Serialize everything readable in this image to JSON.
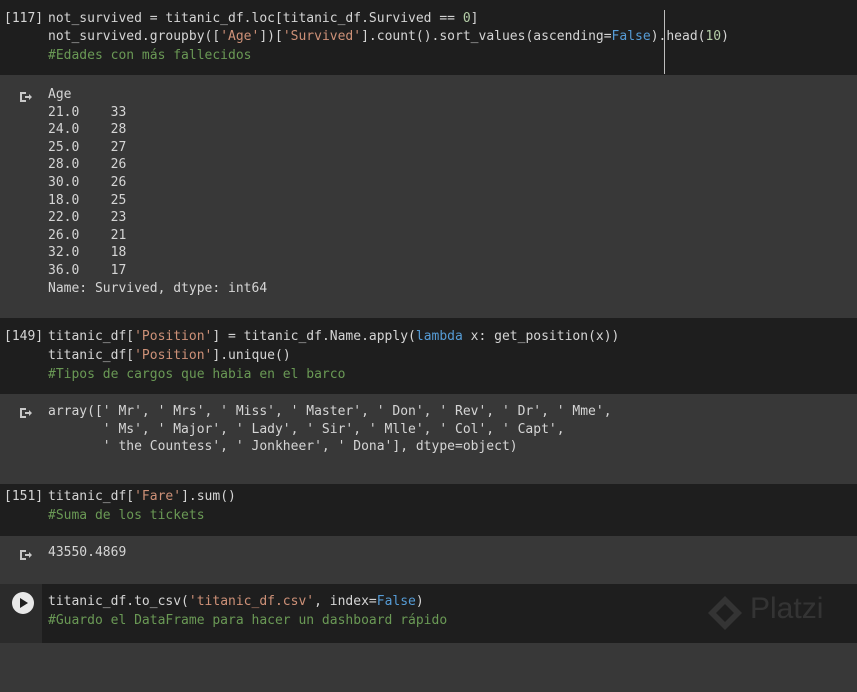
{
  "cells": [
    {
      "prompt": "[117]",
      "code_lines": [
        [
          {
            "t": "not_survived = titanic_df.loc[titanic_df.Survived == "
          },
          {
            "t": "0",
            "c": "num"
          },
          {
            "t": "]"
          }
        ],
        [
          {
            "t": "not_survived.groupby(["
          },
          {
            "t": "'Age'",
            "c": "str"
          },
          {
            "t": "])["
          },
          {
            "t": "'Survived'",
            "c": "str"
          },
          {
            "t": "].count().sort_values(ascending="
          },
          {
            "t": "False",
            "c": "kw"
          },
          {
            "t": ").head("
          },
          {
            "t": "10",
            "c": "num"
          },
          {
            "t": ")"
          }
        ],
        [
          {
            "t": "#Edades con más fallecidos",
            "c": "cmt"
          }
        ]
      ],
      "output": "Age\n21.0    33\n24.0    28\n25.0    27\n28.0    26\n30.0    26\n18.0    25\n22.0    23\n26.0    21\n32.0    18\n36.0    17\nName: Survived, dtype: int64"
    },
    {
      "prompt": "[149]",
      "code_lines": [
        [
          {
            "t": "titanic_df["
          },
          {
            "t": "'Position'",
            "c": "str"
          },
          {
            "t": "] = titanic_df.Name.apply("
          },
          {
            "t": "lambda",
            "c": "kw"
          },
          {
            "t": " x: get_position(x))"
          }
        ],
        [
          {
            "t": "titanic_df["
          },
          {
            "t": "'Position'",
            "c": "str"
          },
          {
            "t": "].unique()"
          }
        ],
        [
          {
            "t": "#Tipos de cargos que habia en el barco",
            "c": "cmt"
          }
        ]
      ],
      "output": "array([' Mr', ' Mrs', ' Miss', ' Master', ' Don', ' Rev', ' Dr', ' Mme',\n       ' Ms', ' Major', ' Lady', ' Sir', ' Mlle', ' Col', ' Capt',\n       ' the Countess', ' Jonkheer', ' Dona'], dtype=object)"
    },
    {
      "prompt": "[151]",
      "code_lines": [
        [
          {
            "t": "titanic_df["
          },
          {
            "t": "'Fare'",
            "c": "str"
          },
          {
            "t": "].sum()"
          }
        ],
        [
          {
            "t": "#Suma de los tickets",
            "c": "cmt"
          }
        ]
      ],
      "output": "43550.4869"
    },
    {
      "prompt": "",
      "code_lines": [
        [
          {
            "t": "titanic_df.to_csv("
          },
          {
            "t": "'titanic_df.csv'",
            "c": "str"
          },
          {
            "t": ", index="
          },
          {
            "t": "False",
            "c": "kw"
          },
          {
            "t": ")"
          }
        ],
        [
          {
            "t": "#Guardo el DataFrame para hacer un dashboard rápido",
            "c": "cmt"
          }
        ]
      ],
      "output": null
    }
  ],
  "icons": {
    "output_icon": "output-arrow-icon",
    "run_icon": "play-icon"
  },
  "watermark": {
    "text": "Platzi"
  },
  "colors": {
    "code_bg": "#1e1e1e",
    "output_bg": "#383838",
    "string": "#ce9178",
    "keyword": "#569cd6",
    "number": "#b5cea8",
    "comment": "#6a9955"
  }
}
